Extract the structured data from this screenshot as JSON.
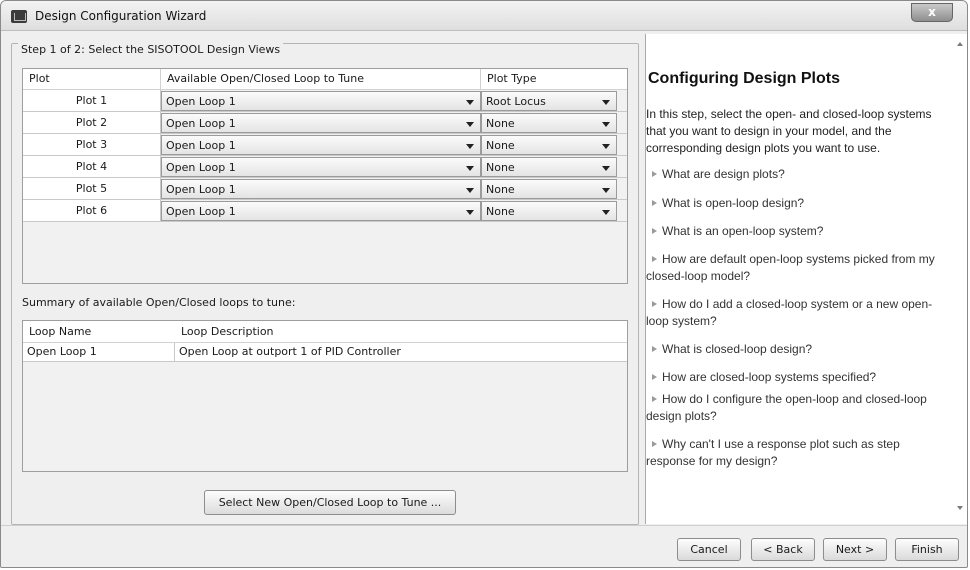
{
  "window": {
    "title": "Design Configuration Wizard",
    "close_label": "x"
  },
  "step": {
    "legend": "Step 1 of 2: Select the SISOTOOL Design Views"
  },
  "design_table": {
    "columns": [
      "Plot",
      "Available Open/Closed Loop to Tune",
      "Plot Type"
    ],
    "rows": [
      {
        "plot": "Plot 1",
        "loop": "Open Loop 1",
        "type": "Root Locus"
      },
      {
        "plot": "Plot 2",
        "loop": "Open Loop 1",
        "type": "None"
      },
      {
        "plot": "Plot 3",
        "loop": "Open Loop 1",
        "type": "None"
      },
      {
        "plot": "Plot 4",
        "loop": "Open Loop 1",
        "type": "None"
      },
      {
        "plot": "Plot 5",
        "loop": "Open Loop 1",
        "type": "None"
      },
      {
        "plot": "Plot 6",
        "loop": "Open Loop 1",
        "type": "None"
      }
    ]
  },
  "summary": {
    "label": "Summary of available Open/Closed loops to tune:",
    "columns": [
      "Loop Name",
      "Loop Description"
    ],
    "rows": [
      {
        "name": "Open Loop 1",
        "description": "Open Loop at outport 1 of PID Controller"
      }
    ]
  },
  "select_new_button": "Select New Open/Closed Loop to Tune ...",
  "help": {
    "title": "Configuring Design Plots",
    "intro": "In this step, select the open- and closed-loop systems that you want to design in your model, and the corresponding design plots you want to use.",
    "links": [
      "What are design plots?",
      "What is open-loop design?",
      "What is an open-loop system?",
      "How are default open-loop systems picked from my closed-loop model?",
      "How do I add a closed-loop system or a new open-loop system?",
      "What is closed-loop design?",
      "How are closed-loop systems specified?",
      "How do I configure the open-loop and closed-loop design plots?",
      "Why can't I use a response plot such as step response for my design?"
    ]
  },
  "footer": {
    "cancel": "Cancel",
    "back": "< Back",
    "next": "Next >",
    "finish": "Finish"
  }
}
